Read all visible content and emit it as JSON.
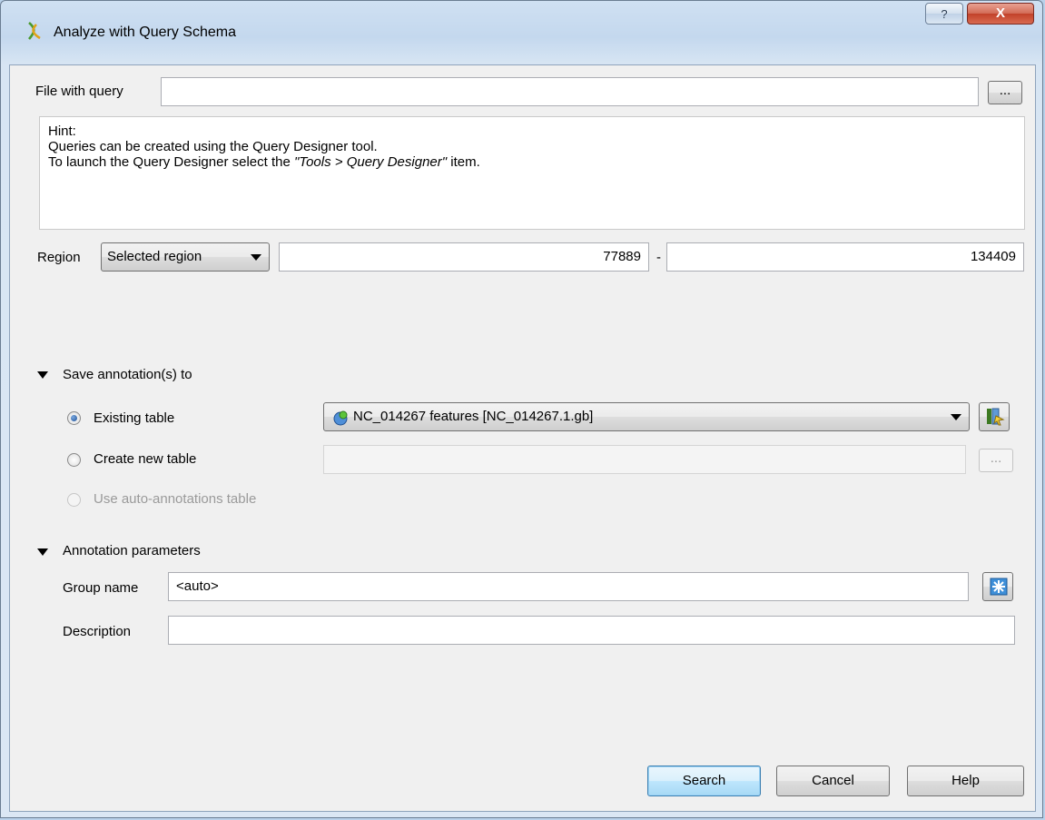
{
  "window": {
    "title": "Analyze with Query Schema",
    "help_button": "?",
    "close_button": "X"
  },
  "file_query": {
    "label": "File with query",
    "value": "",
    "browse_label": "..."
  },
  "hint": {
    "line1": "Hint:",
    "line2": "Queries can be created using the Query Designer tool.",
    "line3_prefix": "To launch the Query Designer select the ",
    "line3_italic": "\"Tools > Query Designer\"",
    "line3_suffix": " item."
  },
  "region": {
    "label": "Region",
    "selected": "Selected region",
    "start": "77889",
    "separator": "-",
    "end": "134409"
  },
  "save_annotations": {
    "section_title": "Save annotation(s) to",
    "existing_table_label": "Existing table",
    "existing_table_value": "NC_014267 features [NC_014267.1.gb]",
    "create_new_label": "Create new table",
    "create_new_value": "",
    "create_new_browse": "...",
    "auto_annotations_label": "Use auto-annotations table",
    "selected_option": "existing"
  },
  "annotation_params": {
    "section_title": "Annotation parameters",
    "group_name_label": "Group name",
    "group_name_value": "<auto>",
    "description_label": "Description",
    "description_value": ""
  },
  "buttons": {
    "search": "Search",
    "cancel": "Cancel",
    "help": "Help"
  }
}
